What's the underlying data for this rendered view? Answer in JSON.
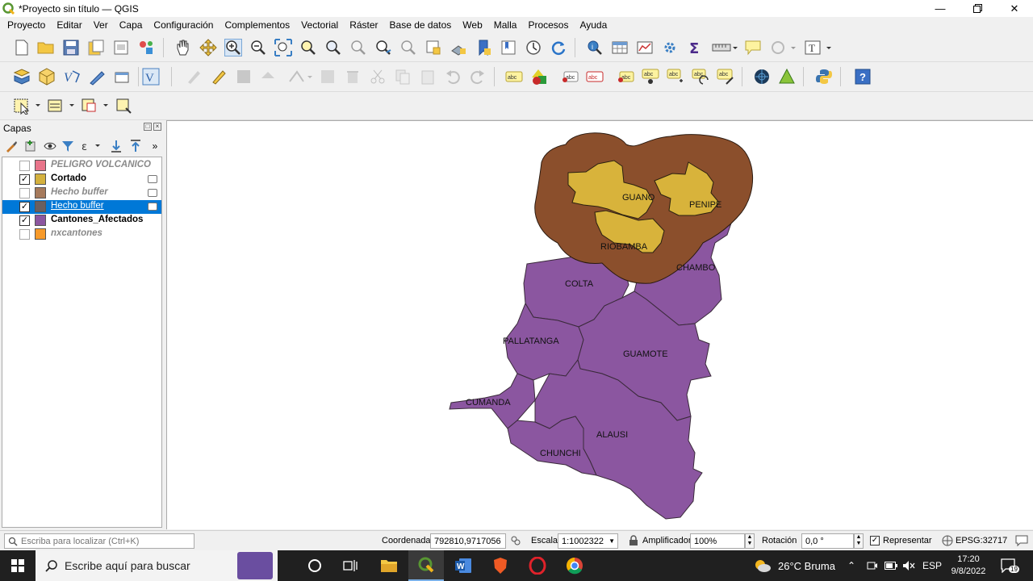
{
  "window": {
    "title": "*Proyecto sin título — QGIS",
    "controls": [
      "minimize-icon",
      "restore-icon",
      "close-icon"
    ]
  },
  "menubar": {
    "items": [
      "Proyecto",
      "Editar",
      "Ver",
      "Capa",
      "Configuración",
      "Complementos",
      "Vectorial",
      "Ráster",
      "Base de datos",
      "Web",
      "Malla",
      "Procesos",
      "Ayuda"
    ]
  },
  "layers_panel": {
    "title": "Capas",
    "layers": [
      {
        "name": "PELIGRO VOLCANICO",
        "checked": false,
        "color": "#e8748a",
        "style": "disabled"
      },
      {
        "name": "Cortado",
        "checked": true,
        "color": "#d4b13e",
        "style": "active"
      },
      {
        "name": "Hecho buffer",
        "checked": false,
        "color": "#a67a5c",
        "style": "disabled"
      },
      {
        "name": "Hecho buffer",
        "checked": true,
        "color": "#6a5f60",
        "style": "selected"
      },
      {
        "name": "Cantones_Afectados",
        "checked": true,
        "color": "#8c56a0",
        "style": "active"
      },
      {
        "name": "nxcantones",
        "checked": false,
        "color": "#f79a2a",
        "style": "disabled"
      }
    ]
  },
  "map": {
    "colors": {
      "buffer": "#8b4f2c",
      "cortado": "#d8b33b",
      "cantones": "#8b56a0",
      "outline": "#3a2a3a"
    },
    "labels": {
      "guano": "GUANO",
      "penipe": "PENIPE",
      "riobamba": "RIOBAMBA",
      "chambo": "CHAMBO",
      "colta": "COLTA",
      "pallatanga": "PALLATANGA",
      "guamote": "GUAMOTE",
      "cumanda": "CUMANDA",
      "alausi": "ALAUSI",
      "chunchi": "CHUNCHI"
    }
  },
  "statusbar": {
    "search_placeholder": "Escriba para localizar (Ctrl+K)",
    "coordinate_label": "Coordenada",
    "coordinate_value": "792810,9717056",
    "scale_label": "Escala",
    "scale_value": "1:1002322",
    "magnifier_label": "Amplificador",
    "magnifier_value": "100%",
    "rotation_label": "Rotación",
    "rotation_value": "0,0 °",
    "render_label": "Representar",
    "render_checked": true,
    "crs": "EPSG:32717"
  },
  "taskbar": {
    "search_text": "Escribe aquí para buscar",
    "weather": "26°C  Bruma",
    "language": "ESP",
    "time": "17:20",
    "date": "9/8/2022",
    "notifications": "19"
  }
}
